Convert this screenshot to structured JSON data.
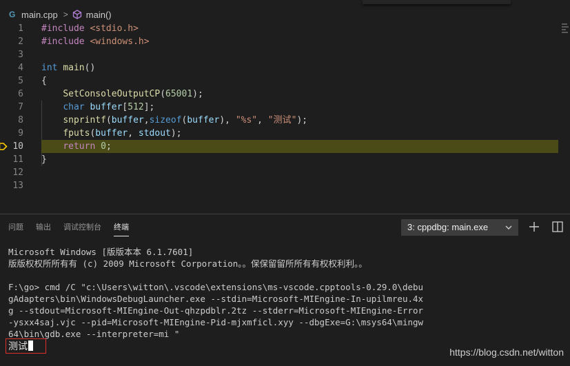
{
  "breadcrumb": {
    "file_icon": "C++-file-icon",
    "file": "main.cpp",
    "separator": ">",
    "symbol_icon": "cube-method-icon",
    "symbol": "main()"
  },
  "editor": {
    "current_line": 10,
    "lines": [
      {
        "num": "1",
        "tokens": [
          {
            "t": "#include",
            "c": "k-dir"
          },
          {
            "t": " ",
            "c": "k-pl"
          },
          {
            "t": "<stdio.h>",
            "c": "k-str"
          }
        ]
      },
      {
        "num": "2",
        "tokens": [
          {
            "t": "#include",
            "c": "k-dir"
          },
          {
            "t": " ",
            "c": "k-pl"
          },
          {
            "t": "<windows.h>",
            "c": "k-str"
          }
        ]
      },
      {
        "num": "3",
        "tokens": []
      },
      {
        "num": "4",
        "tokens": [
          {
            "t": "int",
            "c": "k-kw"
          },
          {
            "t": " ",
            "c": "k-pl"
          },
          {
            "t": "main",
            "c": "k-fn"
          },
          {
            "t": "()",
            "c": "k-pl"
          }
        ]
      },
      {
        "num": "5",
        "tokens": [
          {
            "t": "{",
            "c": "k-pl"
          }
        ]
      },
      {
        "num": "6",
        "tokens": [
          {
            "t": "    ",
            "c": "k-pl"
          },
          {
            "t": "SetConsoleOutputCP",
            "c": "k-fn"
          },
          {
            "t": "(",
            "c": "k-pl"
          },
          {
            "t": "65001",
            "c": "k-num"
          },
          {
            "t": ");",
            "c": "k-pl"
          }
        ]
      },
      {
        "num": "7",
        "tokens": [
          {
            "t": "    ",
            "c": "k-pl"
          },
          {
            "t": "char",
            "c": "k-kw"
          },
          {
            "t": " ",
            "c": "k-pl"
          },
          {
            "t": "buffer",
            "c": "k-var"
          },
          {
            "t": "[",
            "c": "k-pl"
          },
          {
            "t": "512",
            "c": "k-num"
          },
          {
            "t": "];",
            "c": "k-pl"
          }
        ]
      },
      {
        "num": "8",
        "tokens": [
          {
            "t": "    ",
            "c": "k-pl"
          },
          {
            "t": "snprintf",
            "c": "k-fn"
          },
          {
            "t": "(",
            "c": "k-pl"
          },
          {
            "t": "buffer",
            "c": "k-var"
          },
          {
            "t": ",",
            "c": "k-pl"
          },
          {
            "t": "sizeof",
            "c": "k-kw"
          },
          {
            "t": "(",
            "c": "k-pl"
          },
          {
            "t": "buffer",
            "c": "k-var"
          },
          {
            "t": "), ",
            "c": "k-pl"
          },
          {
            "t": "\"%s\"",
            "c": "k-str"
          },
          {
            "t": ", ",
            "c": "k-pl"
          },
          {
            "t": "\"测试\"",
            "c": "k-str"
          },
          {
            "t": ");",
            "c": "k-pl"
          }
        ]
      },
      {
        "num": "9",
        "tokens": [
          {
            "t": "    ",
            "c": "k-pl"
          },
          {
            "t": "fputs",
            "c": "k-fn"
          },
          {
            "t": "(",
            "c": "k-pl"
          },
          {
            "t": "buffer",
            "c": "k-var"
          },
          {
            "t": ", ",
            "c": "k-pl"
          },
          {
            "t": "stdout",
            "c": "k-var"
          },
          {
            "t": ");",
            "c": "k-pl"
          }
        ]
      },
      {
        "num": "10",
        "tokens": [
          {
            "t": "    ",
            "c": "k-pl"
          },
          {
            "t": "return",
            "c": "k-dir"
          },
          {
            "t": " ",
            "c": "k-pl"
          },
          {
            "t": "0",
            "c": "k-num"
          },
          {
            "t": ";",
            "c": "k-pl"
          }
        ]
      },
      {
        "num": "11",
        "tokens": [
          {
            "t": "}",
            "c": "k-pl"
          }
        ]
      },
      {
        "num": "12",
        "tokens": []
      },
      {
        "num": "13",
        "tokens": []
      }
    ]
  },
  "panel": {
    "tabs": [
      {
        "label": "问题",
        "active": false
      },
      {
        "label": "输出",
        "active": false
      },
      {
        "label": "调试控制台",
        "active": false
      },
      {
        "label": "终端",
        "active": true
      }
    ],
    "terminal_select": "3: cppdbg: main.exe",
    "new_terminal_icon": "plus-icon",
    "split_terminal_icon": "split-icon"
  },
  "terminal": {
    "lines": [
      "Microsoft Windows [版版本本 6.1.7601]",
      "版版权权所所有有 (c) 2009 Microsoft Corporation。。保保留留所所有有权权利利。。",
      "",
      "F:\\go> cmd /C \"c:\\Users\\witton\\.vscode\\extensions\\ms-vscode.cpptools-0.29.0\\debu",
      "gAdapters\\bin\\WindowsDebugLauncher.exe --stdin=Microsoft-MIEngine-In-upilmreu.4x",
      "g --stdout=Microsoft-MIEngine-Out-qhzpdblr.2tz --stderr=Microsoft-MIEngine-Error",
      "-ysxx4saj.vjc --pid=Microsoft-MIEngine-Pid-mjxmficl.xyy --dbgExe=G:\\msys64\\mingw",
      "64\\bin\\gdb.exe --interpreter=mi \""
    ],
    "input": "测试"
  },
  "watermark": "https://blog.csdn.net/witton",
  "colors": {
    "editor_bg": "#1e1e1e",
    "highlight_line": "#4b4b18",
    "breakpoint_arrow": "#ffcc00",
    "input_box_border": "#e03131"
  }
}
